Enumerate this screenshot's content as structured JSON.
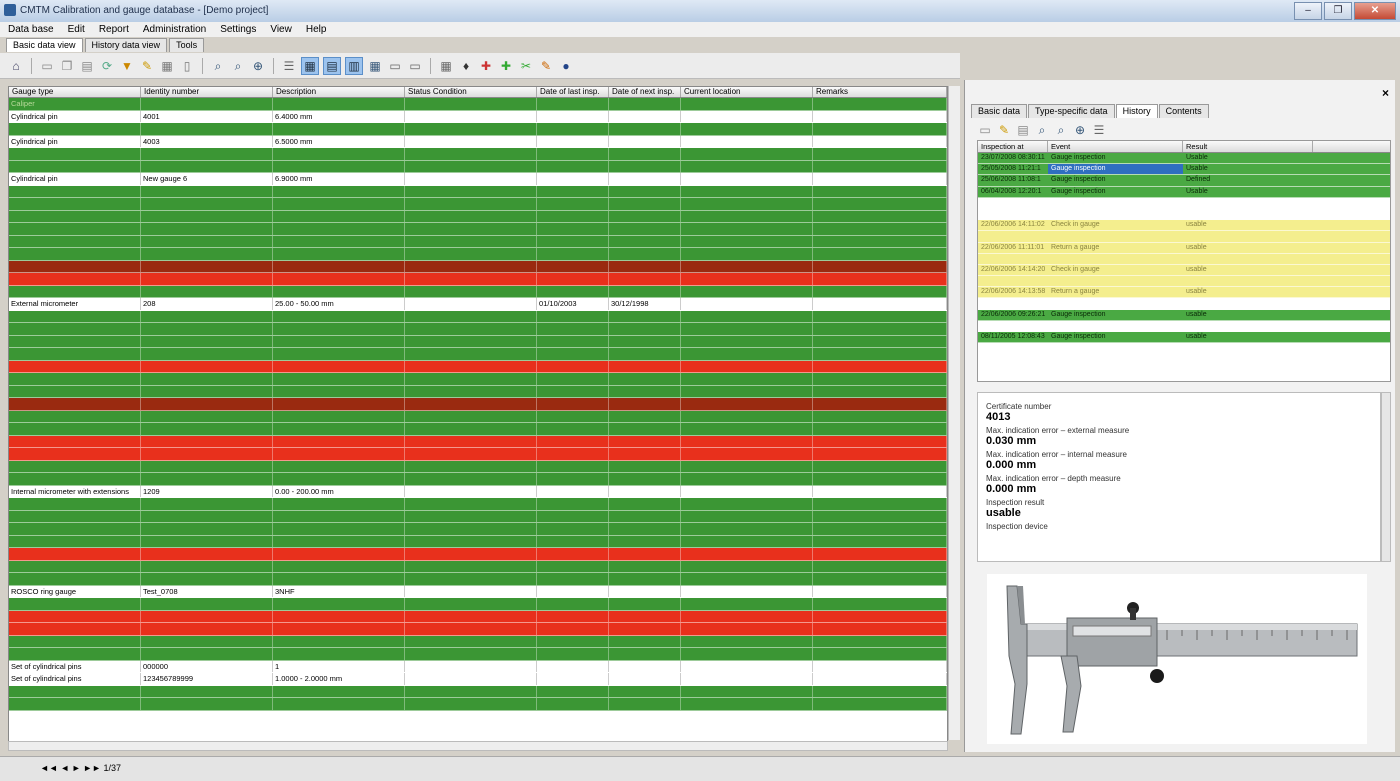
{
  "window": {
    "title": "CMTM Calibration and gauge database - [Demo project]",
    "buttons": [
      "–",
      "❐",
      "✕"
    ]
  },
  "menu": [
    "Data base",
    "Edit",
    "Report",
    "Administration",
    "Settings",
    "View",
    "Help"
  ],
  "main_tabs": [
    "Basic data view",
    "History data view",
    "Tools"
  ],
  "toolbar_icons": [
    "home-icon",
    "new-icon",
    "copy-icon",
    "delete-icon",
    "refresh-icon",
    "filter-icon",
    "edit-icon",
    "print-icon",
    "search-icon",
    "find-next-icon",
    "zoom-icon",
    "list-icon",
    "view-grid-icon",
    "view-list-icon",
    "view-detail-icon",
    "report-icon",
    "export-icon",
    "import-icon",
    "lock-icon",
    "calendar-icon",
    "tools-icon",
    "attach-icon",
    "globe-icon"
  ],
  "grid": {
    "columns": [
      "Gauge type",
      "Identity number",
      "Description",
      "Status Condition",
      "Date of last insp.",
      "Date of next insp.",
      "Current location",
      "Remarks"
    ],
    "rows": [
      {
        "color": "green",
        "cells": [
          "Caliper",
          "",
          "",
          "",
          "",
          "",
          "",
          ""
        ]
      },
      {
        "color": "white",
        "cells": [
          "Cylindrical pin",
          "4001",
          "6.4000 mm",
          "",
          "",
          "",
          "",
          ""
        ]
      },
      {
        "color": "green",
        "cells": [
          "",
          "",
          "",
          "",
          "",
          "",
          "",
          ""
        ]
      },
      {
        "color": "white",
        "cells": [
          "Cylindrical pin",
          "4003",
          "6.5000 mm",
          "",
          "",
          "",
          "",
          ""
        ]
      },
      {
        "color": "green",
        "cells": [
          "",
          "",
          "",
          "",
          "",
          "",
          "",
          ""
        ]
      },
      {
        "color": "green",
        "cells": [
          "",
          "",
          "",
          "",
          "",
          "",
          "",
          ""
        ]
      },
      {
        "color": "white",
        "cells": [
          "Cylindrical pin",
          "New gauge 6",
          "6.9000 mm",
          "",
          "",
          "",
          "",
          ""
        ]
      },
      {
        "color": "green",
        "cells": [
          "",
          "",
          "",
          "",
          "",
          "",
          "",
          ""
        ]
      },
      {
        "color": "green",
        "cells": [
          "",
          "",
          "",
          "",
          "",
          "",
          "",
          ""
        ]
      },
      {
        "color": "green",
        "cells": [
          "",
          "",
          "",
          "",
          "",
          "",
          "",
          ""
        ]
      },
      {
        "color": "green",
        "cells": [
          "",
          "",
          "",
          "",
          "",
          "",
          "",
          ""
        ]
      },
      {
        "color": "green",
        "cells": [
          "",
          "",
          "",
          "",
          "",
          "",
          "",
          ""
        ]
      },
      {
        "color": "green",
        "cells": [
          "",
          "",
          "",
          "",
          "",
          "",
          "",
          ""
        ]
      },
      {
        "color": "darkred",
        "cells": [
          "",
          "",
          "",
          "",
          "",
          "",
          "",
          ""
        ]
      },
      {
        "color": "red",
        "cells": [
          "",
          "",
          "",
          "",
          "",
          "",
          "",
          ""
        ]
      },
      {
        "color": "green",
        "cells": [
          "",
          "",
          "",
          "",
          "",
          "",
          "",
          ""
        ]
      },
      {
        "color": "white",
        "cells": [
          "External micrometer",
          "208",
          "25.00 - 50.00 mm",
          "",
          "01/10/2003",
          "30/12/1998",
          "",
          ""
        ]
      },
      {
        "color": "green",
        "cells": [
          "",
          "",
          "",
          "",
          "",
          "",
          "",
          ""
        ]
      },
      {
        "color": "green",
        "cells": [
          "",
          "",
          "",
          "",
          "",
          "",
          "",
          ""
        ]
      },
      {
        "color": "green",
        "cells": [
          "",
          "",
          "",
          "",
          "",
          "",
          "",
          ""
        ]
      },
      {
        "color": "green",
        "cells": [
          "",
          "",
          "",
          "",
          "",
          "",
          "",
          ""
        ]
      },
      {
        "color": "red",
        "cells": [
          "",
          "",
          "",
          "",
          "",
          "",
          "",
          ""
        ]
      },
      {
        "color": "green",
        "cells": [
          "",
          "",
          "",
          "",
          "",
          "",
          "",
          ""
        ]
      },
      {
        "color": "green",
        "cells": [
          "",
          "",
          "",
          "",
          "",
          "",
          "",
          ""
        ]
      },
      {
        "color": "darkred",
        "cells": [
          "",
          "",
          "",
          "",
          "",
          "",
          "",
          ""
        ]
      },
      {
        "color": "green",
        "cells": [
          "",
          "",
          "",
          "",
          "",
          "",
          "",
          ""
        ]
      },
      {
        "color": "green",
        "cells": [
          "",
          "",
          "",
          "",
          "",
          "",
          "",
          ""
        ]
      },
      {
        "color": "red",
        "cells": [
          "",
          "",
          "",
          "",
          "",
          "",
          "",
          ""
        ]
      },
      {
        "color": "red",
        "cells": [
          "",
          "",
          "",
          "",
          "",
          "",
          "",
          ""
        ]
      },
      {
        "color": "green",
        "cells": [
          "",
          "",
          "",
          "",
          "",
          "",
          "",
          ""
        ]
      },
      {
        "color": "green",
        "cells": [
          "",
          "",
          "",
          "",
          "",
          "",
          "",
          ""
        ]
      },
      {
        "color": "white",
        "cells": [
          "Internal micrometer with extensions",
          "1209",
          "0.00 - 200.00 mm",
          "",
          "",
          "",
          "",
          ""
        ]
      },
      {
        "color": "green",
        "cells": [
          "",
          "",
          "",
          "",
          "",
          "",
          "",
          ""
        ]
      },
      {
        "color": "green",
        "cells": [
          "",
          "",
          "",
          "",
          "",
          "",
          "",
          ""
        ]
      },
      {
        "color": "green",
        "cells": [
          "",
          "",
          "",
          "",
          "",
          "",
          "",
          ""
        ]
      },
      {
        "color": "green",
        "cells": [
          "",
          "",
          "",
          "",
          "",
          "",
          "",
          ""
        ]
      },
      {
        "color": "red",
        "cells": [
          "",
          "",
          "",
          "",
          "",
          "",
          "",
          ""
        ]
      },
      {
        "color": "green",
        "cells": [
          "",
          "",
          "",
          "",
          "",
          "",
          "",
          ""
        ]
      },
      {
        "color": "green",
        "cells": [
          "",
          "",
          "",
          "",
          "",
          "",
          "",
          ""
        ]
      },
      {
        "color": "white",
        "cells": [
          "ROSCO ring gauge",
          "Test_0708",
          "3NHF",
          "",
          "",
          "",
          "",
          ""
        ]
      },
      {
        "color": "green",
        "cells": [
          "",
          "",
          "",
          "",
          "",
          "",
          "",
          ""
        ]
      },
      {
        "color": "red",
        "cells": [
          "",
          "",
          "",
          "",
          "",
          "",
          "",
          ""
        ]
      },
      {
        "color": "red",
        "cells": [
          "",
          "",
          "",
          "",
          "",
          "",
          "",
          ""
        ]
      },
      {
        "color": "green",
        "cells": [
          "",
          "",
          "",
          "",
          "",
          "",
          "",
          ""
        ]
      },
      {
        "color": "green",
        "cells": [
          "",
          "",
          "",
          "",
          "",
          "",
          "",
          ""
        ]
      },
      {
        "color": "white",
        "cells": [
          "Set of cylindrical pins",
          "000000",
          "1",
          "",
          "",
          "",
          "",
          ""
        ]
      },
      {
        "color": "white",
        "cells": [
          "Set of cylindrical pins",
          "123456789999",
          "1.0000 - 2.0000 mm",
          "",
          "",
          "",
          "",
          ""
        ]
      },
      {
        "color": "green",
        "cells": [
          "",
          "",
          "",
          "",
          "",
          "",
          "",
          ""
        ]
      },
      {
        "color": "green",
        "cells": [
          "",
          "",
          "",
          "",
          "",
          "",
          "",
          ""
        ]
      }
    ]
  },
  "statusbar": {
    "nav": "◄◄ ◄ ► ►►   1/37"
  },
  "right_panel": {
    "close": "×",
    "tabs": [
      "Basic data",
      "Type-specific data",
      "History",
      "Contents"
    ],
    "active_tab": 2,
    "history_columns": [
      "Inspection at",
      "Event",
      "Result"
    ],
    "history_rows": [
      {
        "color": "g",
        "cells": [
          "23/07/2008 08:30:11",
          "Gauge inspection",
          "Usable"
        ]
      },
      {
        "color": "g",
        "cells": [
          "25/05/2008 11:21:1",
          "Gauge inspection",
          "Usable"
        ],
        "selected": true
      },
      {
        "color": "g",
        "cells": [
          "25/06/2008 11:08:1",
          "Gauge inspection",
          "Defined"
        ]
      },
      {
        "color": "g",
        "cells": [
          "06/04/2008 12:20:1",
          "Gauge inspection",
          "Usable"
        ]
      },
      {
        "color": "w",
        "cells": [
          "",
          "",
          ""
        ]
      },
      {
        "color": "w",
        "cells": [
          "",
          "",
          ""
        ]
      },
      {
        "color": "y",
        "cells": [
          "22/06/2006 14:11:02",
          "Check in gauge",
          "usable"
        ]
      },
      {
        "color": "y",
        "cells": [
          "",
          "",
          ""
        ]
      },
      {
        "color": "y",
        "cells": [
          "22/06/2006 11:11:01",
          "Return a gauge",
          "usable"
        ]
      },
      {
        "color": "y",
        "cells": [
          "",
          "",
          ""
        ]
      },
      {
        "color": "y",
        "cells": [
          "22/06/2006 14:14:20",
          "Check in gauge",
          "usable"
        ]
      },
      {
        "color": "y",
        "cells": [
          "",
          "",
          ""
        ]
      },
      {
        "color": "y",
        "cells": [
          "22/06/2006 14:13:58",
          "Return a gauge",
          "usable"
        ]
      },
      {
        "color": "w",
        "cells": [
          "",
          "",
          ""
        ]
      },
      {
        "color": "g",
        "cells": [
          "22/06/2006 09:26:21",
          "Gauge inspection",
          "usable"
        ]
      },
      {
        "color": "w",
        "cells": [
          "",
          "",
          ""
        ]
      },
      {
        "color": "g",
        "cells": [
          "08/11/2005 12:08:43",
          "Gauge inspection",
          "usable"
        ]
      }
    ],
    "details": [
      {
        "label": "Certificate number",
        "value": "4013"
      },
      {
        "label": "Max. indication error – external measure",
        "value": "0.030 mm"
      },
      {
        "label": "Max. indication error – internal measure",
        "value": "0.000 mm"
      },
      {
        "label": "Max. indication error – depth measure",
        "value": "0.000 mm"
      },
      {
        "label": "Inspection result",
        "value": "usable"
      },
      {
        "label": "Inspection device",
        "value": ""
      }
    ]
  }
}
